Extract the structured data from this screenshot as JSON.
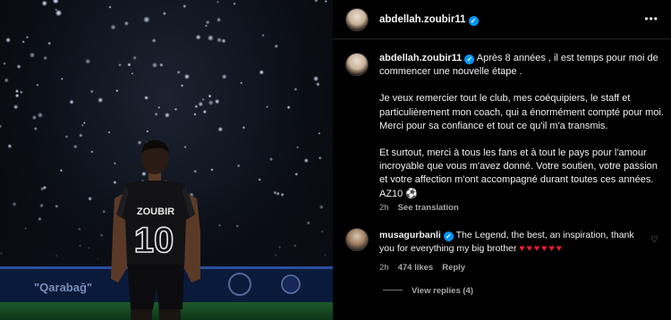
{
  "post": {
    "author": "abdellah.zoubir11",
    "caption": {
      "author": "abdellah.zoubir11",
      "paragraphs": [
        "Après 8 années , il est temps pour moi de commencer une nouvelle étape .",
        "Je veux remercier tout le club, mes coéquipiers, le staff et particulièrement mon coach, qui a énormément compté pour moi. Merci pour sa confiance et tout ce qu'il m'a transmis.",
        "Et surtout, merci à tous les fans et à tout le pays pour l'amour incroyable que vous m'avez donné. Votre soutien, votre passion et votre affection m'ont accompagné durant toutes ces années. AZ10 ⚽"
      ],
      "time": "2h",
      "see_translation": "See translation"
    }
  },
  "photo": {
    "jersey_name": "ZOUBIR",
    "jersey_number": "10",
    "banner_text": "\"Qarabağ\""
  },
  "comment": {
    "author": "musagurbanli",
    "text": "The Legend, the best, an inspiration, thank you for everything my big brother",
    "hearts": "♥♥♥♥♥♥",
    "time": "2h",
    "likes": "474 likes",
    "reply_label": "Reply",
    "view_replies": "View replies (4)"
  },
  "icons": {
    "verified": "verified-badge-icon",
    "more": "more-options-icon",
    "like": "heart-icon"
  },
  "colors": {
    "verified_blue": "#0095f6",
    "heart_red": "#ed1c24",
    "secondary_text": "#a8a8a8"
  }
}
